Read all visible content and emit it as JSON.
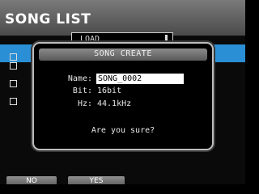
{
  "header": {
    "title": "SONG LIST"
  },
  "menu": {
    "label": "LOAD"
  },
  "dialog": {
    "title": "SONG CREATE",
    "fields": {
      "name_label": "Name:",
      "name_value": "SONG_0002",
      "bit_label": "Bit:",
      "bit_value": "16bit",
      "hz_label": "Hz:",
      "hz_value": "44.1kHz"
    },
    "confirm_text": "Are you sure?"
  },
  "softkeys": {
    "no_label": "NO",
    "yes_label": "YES"
  },
  "colors": {
    "selection": "#2a8fd4",
    "background": "#0a0a0a",
    "header": "#6a6a6a"
  }
}
